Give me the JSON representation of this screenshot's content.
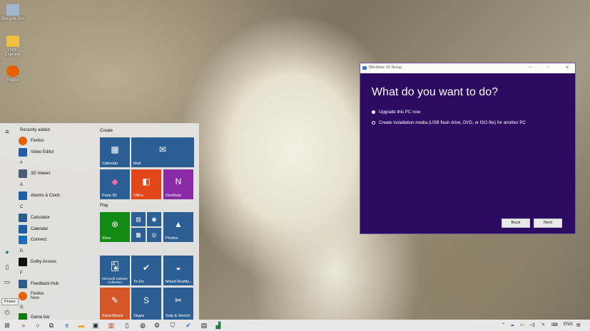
{
  "desktop": {
    "icons": [
      {
        "label": "Recycle Bin",
        "color": "#9fb6cc"
      },
      {
        "label": "UWP Explorer",
        "color": "#f0c040"
      },
      {
        "label": "Firefox",
        "color": "#e66000"
      }
    ]
  },
  "start_menu": {
    "recently_added_label": "Recently added",
    "sections": {
      "hash": "#",
      "a": "A",
      "c": "C",
      "d": "D",
      "f": "F",
      "g": "G"
    },
    "apps": [
      {
        "label": "Firefox",
        "icon": "firefox-icon",
        "color": "#e66000"
      },
      {
        "label": "Video Editor",
        "icon": "video-editor-icon",
        "color": "#1f5fa3"
      },
      {
        "label": "3D Viewer",
        "icon": "3d-viewer-icon",
        "color": "#4a5d72"
      },
      {
        "label": "Alarms & Clock",
        "icon": "alarms-clock-icon",
        "color": "#1f5fa3"
      },
      {
        "label": "Calculator",
        "icon": "calculator-icon",
        "color": "#2d5b8a"
      },
      {
        "label": "Calendar",
        "icon": "calendar-icon",
        "color": "#1f5fa3"
      },
      {
        "label": "Connect",
        "icon": "connect-icon",
        "color": "#1f6fb8"
      },
      {
        "label": "Dolby Access",
        "icon": "dolby-access-icon",
        "color": "#111111"
      },
      {
        "label": "Feedback Hub",
        "icon": "feedback-hub-icon",
        "color": "#2d5b8a"
      },
      {
        "label": "Firefox",
        "sub": "New",
        "icon": "firefox-icon",
        "color": "#e66000"
      },
      {
        "label": "Game bar",
        "icon": "game-bar-icon",
        "color": "#107c10"
      }
    ],
    "groups": {
      "create": "Create",
      "play": "Play"
    },
    "tiles": {
      "calendar": {
        "label": "Calendar",
        "color": "#2b5f93"
      },
      "mail": {
        "label": "Mail",
        "color": "#2b5f93"
      },
      "paint3d": {
        "label": "Paint 3D",
        "color": "#2b5f93"
      },
      "office": {
        "label": "Office",
        "color": "#e2471a"
      },
      "onenote": {
        "label": "OneNote",
        "color": "#8a2aa6"
      },
      "xbox": {
        "label": "Xbox",
        "color": "#138a13"
      },
      "photos": {
        "label": "Photos",
        "color": "#2b5f93"
      },
      "solitaire": {
        "label": "Microsoft Solitaire Collection",
        "color": "#2b5f93"
      },
      "todo": {
        "label": "To-Do",
        "color": "#2b5f93"
      },
      "mixed_reality": {
        "label": "Mixed Reality...",
        "color": "#2b5f93"
      },
      "sketchbook": {
        "label": "SketchBook",
        "color": "#d4572a"
      },
      "skype": {
        "label": "Skype",
        "color": "#2b5f93"
      },
      "snip_sketch": {
        "label": "Snip & Sketch",
        "color": "#2b5f93"
      }
    },
    "power_tooltip": "Power"
  },
  "setup_window": {
    "title": "Windows 10 Setup",
    "heading": "What do you want to do?",
    "options": [
      {
        "label": "Upgrade this PC now",
        "selected": true
      },
      {
        "label": "Create installation media (USB flash drive, DVD, or ISO file) for another PC",
        "selected": false
      }
    ],
    "back_label": "Back",
    "next_label": "Next",
    "bg_color": "#2d0a62"
  },
  "taskbar": {
    "language": "ENG"
  }
}
